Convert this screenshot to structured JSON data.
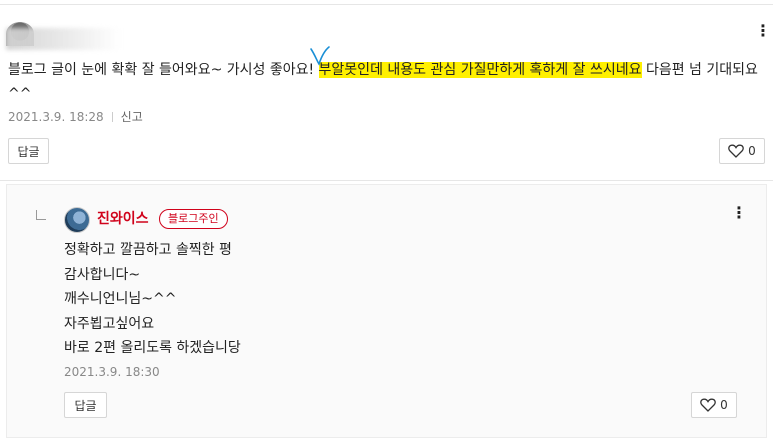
{
  "comment": {
    "text_before": "블로그 글이 눈에 확확 잘 들어와요~ 가시성 좋아요! ",
    "text_highlight": "부알못인데 내용도 관심 가질만하게 혹하게 잘 쓰시네요",
    "text_after": " 다음편 넘 기대되요 ^^",
    "timestamp": "2021.3.9. 18:28",
    "report_label": "신고",
    "reply_button": "답글",
    "like_count": "0",
    "highlight_color": "#fff000"
  },
  "reply": {
    "author": "진와이스",
    "badge": "블로그주인",
    "lines": [
      "정확하고 깔끔하고 솔찍한 평",
      "감사합니다~",
      "깨수니언니님~^^",
      "자주뵙고싶어요",
      "바로 2편 올리도록 하겠습니당"
    ],
    "timestamp": "2021.3.9. 18:30",
    "reply_button": "답글",
    "like_count": "0",
    "accent_color": "#d0021b"
  }
}
